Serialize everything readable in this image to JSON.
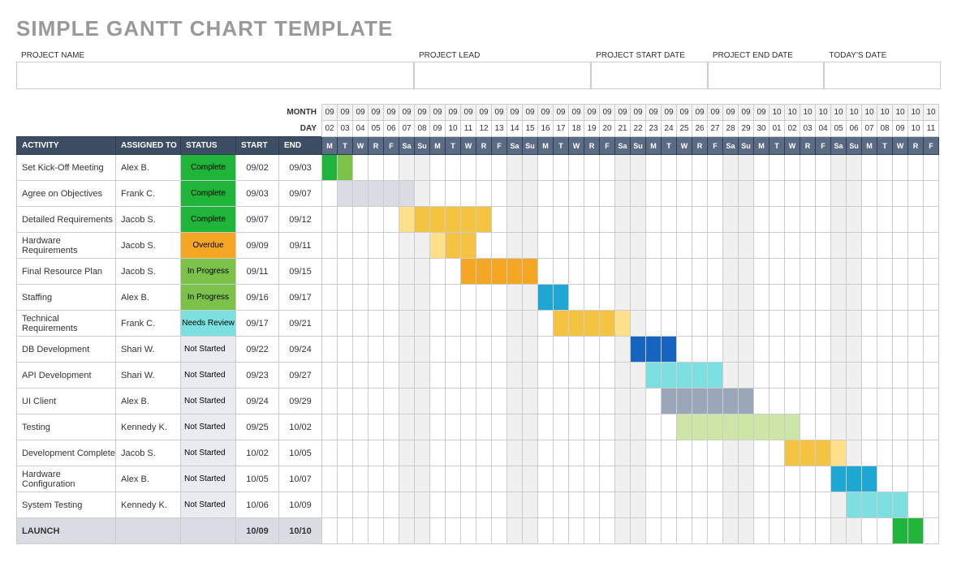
{
  "title": "SIMPLE GANTT CHART TEMPLATE",
  "info_labels": {
    "project_name": "PROJECT NAME",
    "project_lead": "PROJECT LEAD",
    "start_date": "PROJECT START DATE",
    "end_date": "PROJECT END DATE",
    "today": "TODAY'S DATE"
  },
  "axis_labels": {
    "month": "MONTH",
    "day": "DAY"
  },
  "headers": {
    "activity": "ACTIVITY",
    "assigned": "ASSIGNED TO",
    "status": "STATUS",
    "start": "START",
    "end": "END"
  },
  "calendar": {
    "months": [
      "09",
      "09",
      "09",
      "09",
      "09",
      "09",
      "09",
      "09",
      "09",
      "09",
      "09",
      "09",
      "09",
      "09",
      "09",
      "09",
      "09",
      "09",
      "09",
      "09",
      "09",
      "09",
      "09",
      "09",
      "09",
      "09",
      "09",
      "09",
      "09",
      "10",
      "10",
      "10",
      "10",
      "10",
      "10",
      "10",
      "10",
      "10",
      "10",
      "10"
    ],
    "days": [
      "02",
      "03",
      "04",
      "05",
      "06",
      "07",
      "08",
      "09",
      "10",
      "11",
      "12",
      "13",
      "14",
      "15",
      "16",
      "17",
      "18",
      "19",
      "20",
      "21",
      "22",
      "23",
      "24",
      "25",
      "26",
      "27",
      "28",
      "29",
      "30",
      "01",
      "02",
      "03",
      "04",
      "05",
      "06",
      "07",
      "08",
      "09",
      "10",
      "11"
    ],
    "dow": [
      "M",
      "T",
      "W",
      "R",
      "F",
      "Sa",
      "Su",
      "M",
      "T",
      "W",
      "R",
      "F",
      "Sa",
      "Su",
      "M",
      "T",
      "W",
      "R",
      "F",
      "Sa",
      "Su",
      "M",
      "T",
      "W",
      "R",
      "F",
      "Sa",
      "Su",
      "M",
      "T",
      "W",
      "R",
      "F",
      "Sa",
      "Su",
      "M",
      "T",
      "W",
      "R",
      "F"
    ]
  },
  "status_labels": {
    "complete": "Complete",
    "overdue": "Overdue",
    "inprogress": "In Progress",
    "review": "Needs Review",
    "notstarted": "Not Started"
  },
  "rows": [
    {
      "activity": "Set Kick-Off Meeting",
      "assigned": "Alex B.",
      "status": "complete",
      "start": "09/02",
      "end": "09/03"
    },
    {
      "activity": "Agree on Objectives",
      "assigned": "Frank C.",
      "status": "complete",
      "start": "09/03",
      "end": "09/07"
    },
    {
      "activity": "Detailed Requirements",
      "assigned": "Jacob S.",
      "status": "complete",
      "start": "09/07",
      "end": "09/12"
    },
    {
      "activity": "Hardware Requirements",
      "assigned": "Jacob S.",
      "status": "overdue",
      "start": "09/09",
      "end": "09/11"
    },
    {
      "activity": "Final Resource Plan",
      "assigned": "Jacob S.",
      "status": "inprogress",
      "start": "09/11",
      "end": "09/15"
    },
    {
      "activity": "Staffing",
      "assigned": "Alex B.",
      "status": "inprogress",
      "start": "09/16",
      "end": "09/17"
    },
    {
      "activity": "Technical Requirements",
      "assigned": "Frank C.",
      "status": "review",
      "start": "09/17",
      "end": "09/21"
    },
    {
      "activity": "DB Development",
      "assigned": "Shari W.",
      "status": "notstarted",
      "start": "09/22",
      "end": "09/24"
    },
    {
      "activity": "API Development",
      "assigned": "Shari W.",
      "status": "notstarted",
      "start": "09/23",
      "end": "09/27"
    },
    {
      "activity": "UI Client",
      "assigned": "Alex B.",
      "status": "notstarted",
      "start": "09/24",
      "end": "09/29"
    },
    {
      "activity": "Testing",
      "assigned": "Kennedy K.",
      "status": "notstarted",
      "start": "09/25",
      "end": "10/02"
    },
    {
      "activity": "Development Complete",
      "assigned": "Jacob S.",
      "status": "notstarted",
      "start": "10/02",
      "end": "10/05"
    },
    {
      "activity": "Hardware Configuration",
      "assigned": "Alex B.",
      "status": "notstarted",
      "start": "10/05",
      "end": "10/07"
    },
    {
      "activity": "System Testing",
      "assigned": "Kennedy K.",
      "status": "notstarted",
      "start": "10/06",
      "end": "10/09"
    },
    {
      "activity": "LAUNCH",
      "assigned": "",
      "status": "",
      "start": "10/09",
      "end": "10/10",
      "launch": true
    }
  ],
  "chart_data": {
    "type": "gantt",
    "title": "SIMPLE GANTT CHART TEMPLATE",
    "x_unit": "day",
    "x_start": "09/02",
    "x_end": "10/11",
    "series": [
      {
        "name": "Set Kick-Off Meeting",
        "assigned": "Alex B.",
        "status": "Complete",
        "bar": {
          "from": "09/02",
          "to": "09/03",
          "colors": [
            "#1eb53a",
            "#7cc24a"
          ]
        }
      },
      {
        "name": "Agree on Objectives",
        "assigned": "Frank C.",
        "status": "Complete",
        "bar": {
          "from": "09/03",
          "to": "09/07",
          "colors": [
            "#d9dde3",
            "#d9dde3",
            "#d9dde3",
            "#d9dde3",
            "#d9dde3"
          ]
        }
      },
      {
        "name": "Detailed Requirements",
        "assigned": "Jacob S.",
        "status": "Complete",
        "bar": {
          "from": "09/07",
          "to": "09/12",
          "colors": [
            "#ffe08a",
            "#f5c342",
            "#f5c342",
            "#f5c342",
            "#f5c342",
            "#f5c342"
          ]
        }
      },
      {
        "name": "Hardware Requirements",
        "assigned": "Jacob S.",
        "status": "Overdue",
        "bar": {
          "from": "09/09",
          "to": "09/11",
          "colors": [
            "#ffe08a",
            "#f5c342",
            "#f5c342"
          ]
        }
      },
      {
        "name": "Final Resource Plan",
        "assigned": "Jacob S.",
        "status": "In Progress",
        "bar": {
          "from": "09/11",
          "to": "09/15",
          "colors": [
            "#f5a623",
            "#f5a623",
            "#f5a623",
            "#f5a623",
            "#f5a623"
          ]
        }
      },
      {
        "name": "Staffing",
        "assigned": "Alex B.",
        "status": "In Progress",
        "bar": {
          "from": "09/16",
          "to": "09/17",
          "colors": [
            "#1fa7d4",
            "#1fa7d4"
          ]
        }
      },
      {
        "name": "Technical Requirements",
        "assigned": "Frank C.",
        "status": "Needs Review",
        "bar": {
          "from": "09/17",
          "to": "09/21",
          "colors": [
            "#f5c342",
            "#f5c342",
            "#f5c342",
            "#f5c342",
            "#ffe08a"
          ]
        }
      },
      {
        "name": "DB Development",
        "assigned": "Shari W.",
        "status": "Not Started",
        "bar": {
          "from": "09/22",
          "to": "09/24",
          "colors": [
            "#1565c0",
            "#1565c0",
            "#1565c0"
          ]
        }
      },
      {
        "name": "API Development",
        "assigned": "Shari W.",
        "status": "Not Started",
        "bar": {
          "from": "09/23",
          "to": "09/27",
          "colors": [
            "#7de0e0",
            "#7de0e0",
            "#7de0e0",
            "#7de0e0",
            "#7de0e0"
          ]
        }
      },
      {
        "name": "UI Client",
        "assigned": "Alex B.",
        "status": "Not Started",
        "bar": {
          "from": "09/24",
          "to": "09/29",
          "colors": [
            "#9aa7b8",
            "#9aa7b8",
            "#9aa7b8",
            "#9aa7b8",
            "#9aa7b8",
            "#9aa7b8"
          ]
        }
      },
      {
        "name": "Testing",
        "assigned": "Kennedy K.",
        "status": "Not Started",
        "bar": {
          "from": "09/25",
          "to": "10/02",
          "colors": [
            "#cde6a5",
            "#cde6a5",
            "#cde6a5",
            "#cde6a5",
            "#cde6a5",
            "#cde6a5",
            "#cde6a5",
            "#cde6a5"
          ]
        }
      },
      {
        "name": "Development Complete",
        "assigned": "Jacob S.",
        "status": "Not Started",
        "bar": {
          "from": "10/02",
          "to": "10/05",
          "colors": [
            "#f5c342",
            "#f5c342",
            "#f5c342",
            "#ffe08a"
          ]
        }
      },
      {
        "name": "Hardware Configuration",
        "assigned": "Alex B.",
        "status": "Not Started",
        "bar": {
          "from": "10/05",
          "to": "10/07",
          "colors": [
            "#1fa7d4",
            "#1fa7d4",
            "#1fa7d4"
          ]
        }
      },
      {
        "name": "System Testing",
        "assigned": "Kennedy K.",
        "status": "Not Started",
        "bar": {
          "from": "10/06",
          "to": "10/09",
          "colors": [
            "#7de0e0",
            "#7de0e0",
            "#7de0e0",
            "#7de0e0"
          ]
        }
      },
      {
        "name": "LAUNCH",
        "assigned": "",
        "status": "",
        "bar": {
          "from": "10/09",
          "to": "10/10",
          "colors": [
            "#1eb53a",
            "#1eb53a"
          ]
        }
      }
    ]
  }
}
